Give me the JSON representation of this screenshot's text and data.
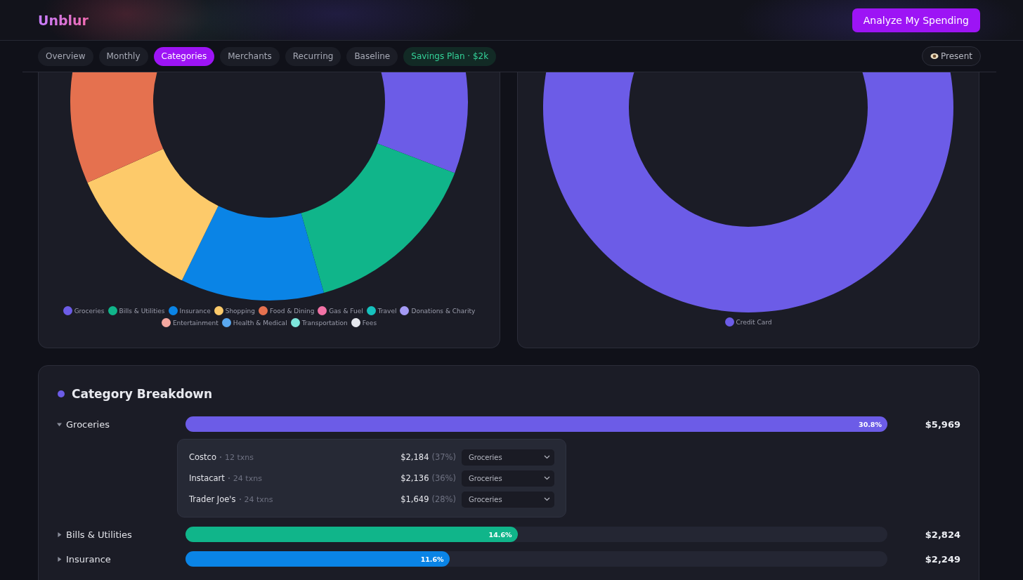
{
  "brand": "Unblur",
  "cta": "Analyze My Spending",
  "tabs": [
    {
      "label": "Overview",
      "selected": false,
      "kind": "tab"
    },
    {
      "label": "Monthly",
      "selected": false,
      "kind": "tab"
    },
    {
      "label": "Categories",
      "selected": true,
      "kind": "tab"
    },
    {
      "label": "Merchants",
      "selected": false,
      "kind": "tab"
    },
    {
      "label": "Recurring",
      "selected": false,
      "kind": "tab"
    },
    {
      "label": "Baseline",
      "selected": false,
      "kind": "tab"
    },
    {
      "label": "Savings Plan · $2k",
      "selected": false,
      "kind": "savings"
    }
  ],
  "present": "Present",
  "category_chart": {
    "legend": [
      {
        "label": "Groceries",
        "color": "#6c5ce7"
      },
      {
        "label": "Bills & Utilities",
        "color": "#10b58a"
      },
      {
        "label": "Insurance",
        "color": "#0a84e6"
      },
      {
        "label": "Shopping",
        "color": "#fdca6a"
      },
      {
        "label": "Food & Dining",
        "color": "#e5714f"
      },
      {
        "label": "Gas & Fuel",
        "color": "#f272a6"
      },
      {
        "label": "Travel",
        "color": "#16c1bd"
      },
      {
        "label": "Donations & Charity",
        "color": "#a49af5"
      },
      {
        "label": "Entertainment",
        "color": "#f5a8a0"
      },
      {
        "label": "Health & Medical",
        "color": "#5aa8ef"
      },
      {
        "label": "Transportation",
        "color": "#7ee6dc"
      },
      {
        "label": "Fees",
        "color": "#e6e8ee"
      }
    ]
  },
  "account_chart": {
    "legend": [
      {
        "label": "Credit Card",
        "color": "#6c5ce7"
      }
    ]
  },
  "breakdown": {
    "title": "Category Breakdown",
    "rows": [
      {
        "name": "Groceries",
        "expanded": true,
        "level": 1.0,
        "percent": "30.8%",
        "amount": "$5,969",
        "color": "#6c5ce7",
        "merchants": [
          {
            "name": "Costco",
            "txns": "12 txns",
            "amount": "$2,184",
            "share": "(37%)",
            "category": "Groceries"
          },
          {
            "name": "Instacart",
            "txns": "24 txns",
            "amount": "$2,136",
            "share": "(36%)",
            "category": "Groceries"
          },
          {
            "name": "Trader Joe's",
            "txns": "24 txns",
            "amount": "$1,649",
            "share": "(28%)",
            "category": "Groceries"
          }
        ]
      },
      {
        "name": "Bills & Utilities",
        "expanded": false,
        "level": 0.473,
        "percent": "14.6%",
        "amount": "$2,824",
        "color": "#10b58a"
      },
      {
        "name": "Insurance",
        "expanded": false,
        "level": 0.376,
        "percent": "11.6%",
        "amount": "$2,249",
        "color": "#0a84e6"
      }
    ]
  }
}
